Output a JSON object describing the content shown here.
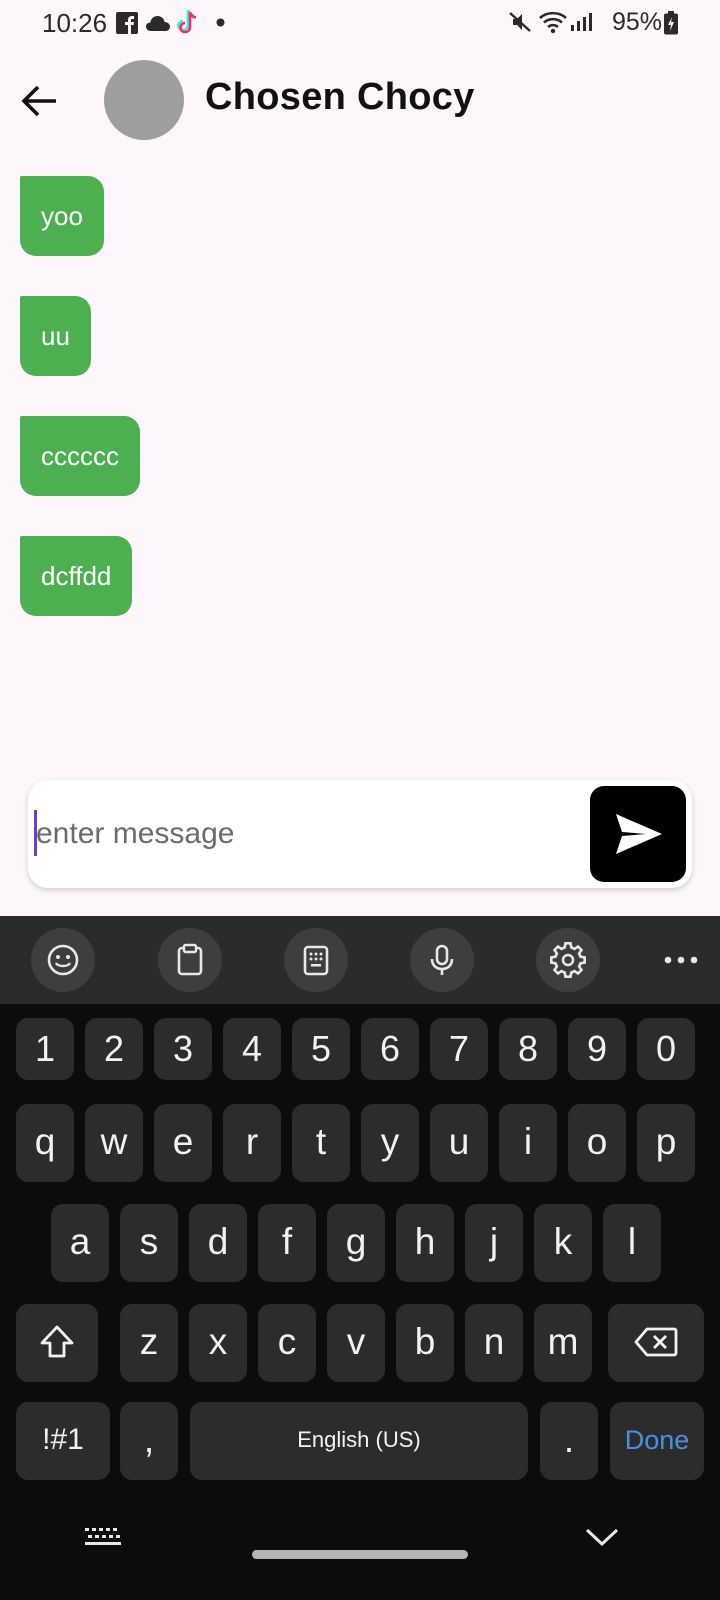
{
  "status_bar": {
    "time": "10:26",
    "battery": "95%",
    "icons": [
      "facebook-icon",
      "cloud-icon",
      "tiktok-icon",
      "dot-icon",
      "mute-icon",
      "wifi-icon",
      "signal-icon",
      "battery-icon"
    ]
  },
  "header": {
    "contact_name": "Chosen Chocy"
  },
  "messages": [
    {
      "text": "yoo"
    },
    {
      "text": "uu"
    },
    {
      "text": "cccccc"
    },
    {
      "text": "dcffdd"
    }
  ],
  "colors": {
    "bubble": "#4caf50",
    "background": "#fdf7fc",
    "send_button": "#000000",
    "keyboard": "#0c0c0c",
    "key": "#2c2c2c",
    "done_accent": "#4a90e2"
  },
  "composer": {
    "placeholder": "enter message",
    "value": ""
  },
  "keyboard": {
    "toolbar": [
      "emoji-icon",
      "clipboard-icon",
      "keypad-icon",
      "microphone-icon",
      "settings-icon",
      "more-icon"
    ],
    "numbers": [
      "1",
      "2",
      "3",
      "4",
      "5",
      "6",
      "7",
      "8",
      "9",
      "0"
    ],
    "row1": [
      "q",
      "w",
      "e",
      "r",
      "t",
      "y",
      "u",
      "i",
      "o",
      "p"
    ],
    "row2": [
      "a",
      "s",
      "d",
      "f",
      "g",
      "h",
      "j",
      "k",
      "l"
    ],
    "row3": [
      "z",
      "x",
      "c",
      "v",
      "b",
      "n",
      "m"
    ],
    "symbols_label": "!#1",
    "comma": ",",
    "space_label": "English (US)",
    "period": ".",
    "done_label": "Done"
  }
}
